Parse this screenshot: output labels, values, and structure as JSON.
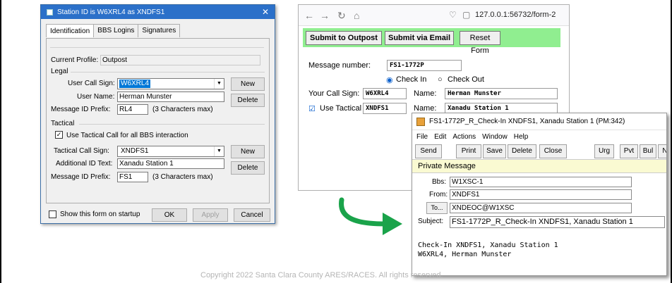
{
  "station_dialog": {
    "title": "Station ID is W6XRL4 as XNDFS1",
    "tabs": [
      "Identification",
      "BBS Logins",
      "Signatures"
    ],
    "current_profile_label": "Current Profile:",
    "current_profile_value": "Outpost",
    "legal": {
      "group_label": "Legal",
      "user_call_sign_label": "User Call Sign:",
      "user_call_sign_value": "W6XRL4",
      "user_name_label": "User Name:",
      "user_name_value": "Herman Munster",
      "message_id_prefix_label": "Message ID Prefix:",
      "message_id_prefix_value": "RL4",
      "chars_max_note": "(3 Characters max)",
      "new_label": "New",
      "delete_label": "Delete"
    },
    "tactical": {
      "group_label": "Tactical",
      "use_tactical_label": "Use Tactical Call for all BBS interaction",
      "use_tactical_checked": true,
      "tactical_call_sign_label": "Tactical Call Sign:",
      "tactical_call_sign_value": "XNDFS1",
      "additional_id_label": "Additional ID Text:",
      "additional_id_value": "Xanadu Station 1",
      "message_id_prefix_label": "Message ID Prefix:",
      "message_id_prefix_value": "FS1",
      "chars_max_note": "(3 Characters max)",
      "new_label": "New",
      "delete_label": "Delete"
    },
    "show_on_startup_label": "Show this form on startup",
    "ok_label": "OK",
    "apply_label": "Apply",
    "cancel_label": "Cancel"
  },
  "browser": {
    "url": "127.0.0.1:56732/form-2",
    "submit_outpost_label": "Submit to Outpost",
    "submit_email_label": "Submit via Email",
    "reset_label": "Reset Form",
    "message_number_label": "Message number:",
    "message_number_value": "FS1-1772P",
    "check_in_label": "Check In",
    "check_out_label": "Check Out",
    "your_call_sign_label": "Your Call Sign:",
    "your_call_sign_value": "W6XRL4",
    "name_label": "Name:",
    "name_value": "Herman Munster",
    "use_tactical_label": "Use Tactical Call:",
    "tactical_value": "XNDFS1",
    "tactical_name_label": "Name:",
    "tactical_name_value": "Xanadu Station 1"
  },
  "message_window": {
    "title": "FS1-1772P_R_Check-In XNDFS1, Xanadu Station 1 (PM:342)",
    "menu": [
      "File",
      "Edit",
      "Actions",
      "Window",
      "Help"
    ],
    "toolbar": [
      "Send",
      "Print",
      "Save",
      "Delete",
      "Close",
      "Urg",
      "Pvt",
      "Bul",
      "N"
    ],
    "private_label": "Private Message",
    "bbs_label": "Bbs:",
    "bbs_value": "W1XSC-1",
    "from_label": "From:",
    "from_value": "XNDFS1",
    "to_label": "To...",
    "to_value": "XNDEOC@W1XSC",
    "subject_label": "Subject:",
    "subject_value": "FS1-1772P_R_Check-In XNDFS1, Xanadu Station 1",
    "body_line1": "Check-In XNDFS1, Xanadu Station 1",
    "body_line2": "W6XRL4, Herman Munster"
  },
  "copyright": "Copyright 2022 Santa Clara County ARES/RACES.  All rights reserved.",
  "colors": {
    "form_button_bar": "#90ee90",
    "private_message_bar": "#fafad2",
    "arrow": "#1aa34a"
  }
}
